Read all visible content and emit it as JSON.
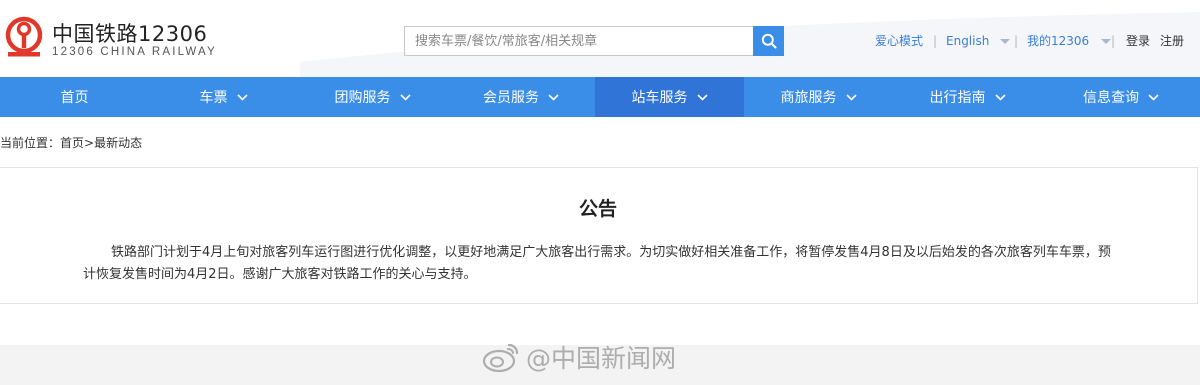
{
  "brand": {
    "name_cn": "中国铁路12306",
    "name_en": "12306 CHINA RAILWAY",
    "logo_color": "#e0392b"
  },
  "search": {
    "placeholder": "搜索车票/餐饮/常旅客/相关规章",
    "button_icon": "search-icon"
  },
  "top_links": {
    "care_mode": "爱心模式",
    "separator": "|",
    "language": "English",
    "my12306": "我的12306",
    "login": "登录",
    "register": "注册"
  },
  "nav": {
    "items": [
      {
        "label": "首页",
        "has_dropdown": false
      },
      {
        "label": "车票",
        "has_dropdown": true
      },
      {
        "label": "团购服务",
        "has_dropdown": true
      },
      {
        "label": "会员服务",
        "has_dropdown": true
      },
      {
        "label": "站车服务",
        "has_dropdown": true,
        "active": true
      },
      {
        "label": "商旅服务",
        "has_dropdown": true
      },
      {
        "label": "出行指南",
        "has_dropdown": true
      },
      {
        "label": "信息查询",
        "has_dropdown": true
      }
    ]
  },
  "breadcrumb": {
    "prefix": "当前位置：",
    "home": "首页",
    "separator": ">",
    "current": "最新动态"
  },
  "notice": {
    "title": "公告",
    "body": "铁路部门计划于4月上旬对旅客列车运行图进行优化调整，以更好地满足广大旅客出行需求。为切实做好相关准备工作，将暂停发售4月8日及以后始发的各次旅客列车车票，预计恢复发售时间为4月2日。感谢广大旅客对铁路工作的关心与支持。"
  },
  "watermark": {
    "text": "@中国新闻网",
    "icon": "weibo-icon"
  },
  "colors": {
    "nav_bg": "#3b8ee8",
    "nav_active": "#2f74d6",
    "link_blue": "#3b7ed6"
  }
}
